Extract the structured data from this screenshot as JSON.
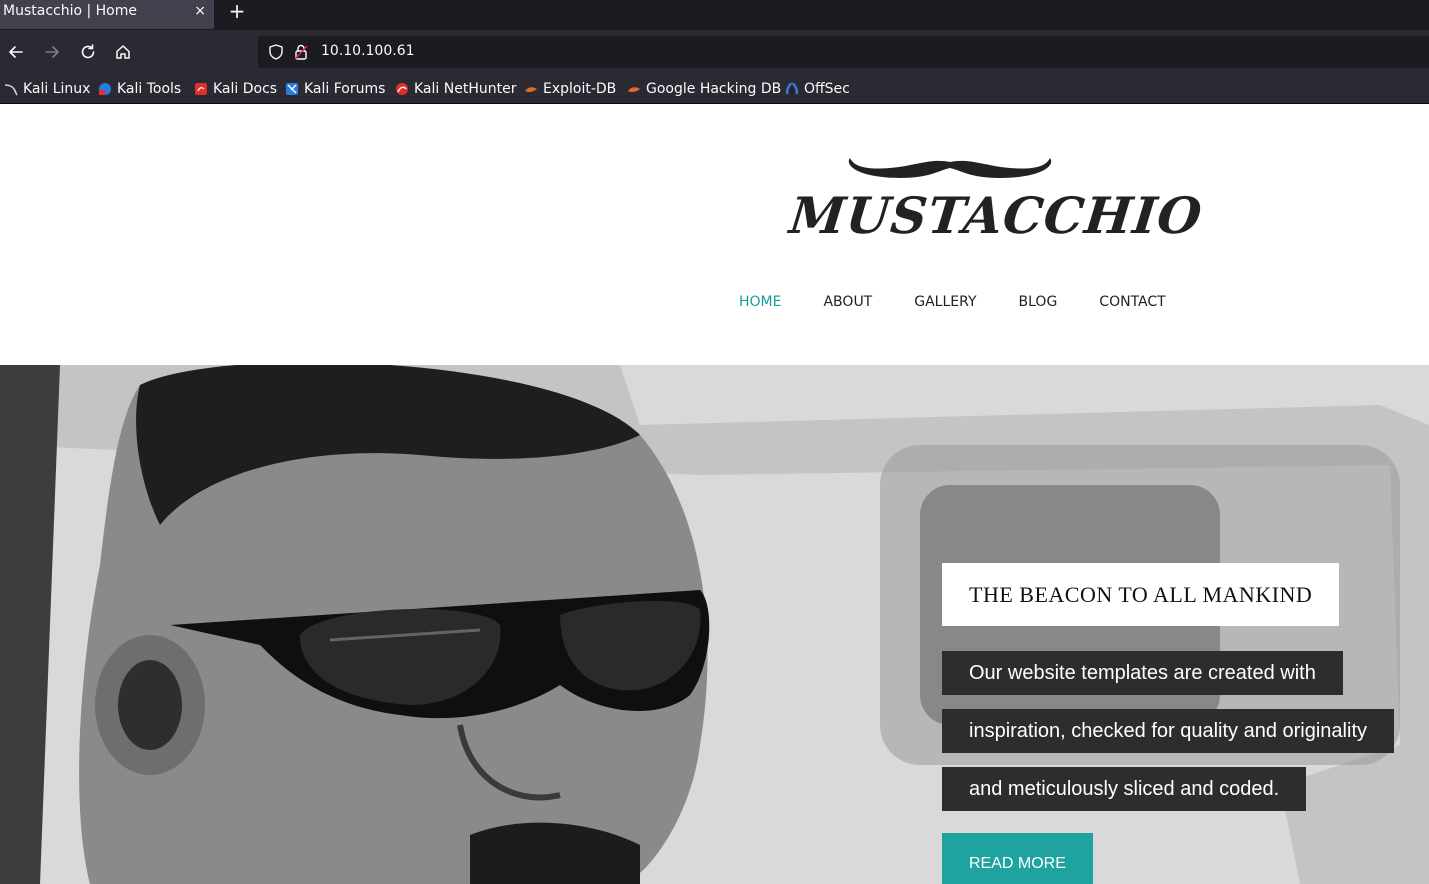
{
  "browser": {
    "tab_title": "Mustacchio | Home",
    "close_glyph": "×",
    "newtab_glyph": "+",
    "url": "10.10.100.61",
    "bookmarks": [
      {
        "label": "Kali Linux",
        "icon": "kali-dragon-icon",
        "color": "#2a7bde"
      },
      {
        "label": "Kali Tools",
        "icon": "kali-tools-icon",
        "color": "#2a7bde"
      },
      {
        "label": "Kali Docs",
        "icon": "kali-docs-icon",
        "color": "#e0302a"
      },
      {
        "label": "Kali Forums",
        "icon": "kali-forums-icon",
        "color": "#2a7bde"
      },
      {
        "label": "Kali NetHunter",
        "icon": "kali-nethunter-icon",
        "color": "#e0302a"
      },
      {
        "label": "Exploit-DB",
        "icon": "exploit-db-icon",
        "color": "#e06a2a"
      },
      {
        "label": "Google Hacking DB",
        "icon": "ghdb-icon",
        "color": "#e06a2a"
      },
      {
        "label": "OffSec",
        "icon": "offsec-icon",
        "color": "#3a7bde"
      }
    ]
  },
  "site": {
    "logo_text": "MUSTACCHIO",
    "nav": [
      {
        "label": "HOME",
        "active": true
      },
      {
        "label": "ABOUT",
        "active": false
      },
      {
        "label": "GALLERY",
        "active": false
      },
      {
        "label": "BLOG",
        "active": false
      },
      {
        "label": "CONTACT",
        "active": false
      }
    ],
    "accent_color": "#1a9c9c"
  },
  "hero": {
    "title": "THE BEACON TO ALL MANKIND",
    "lines": [
      "Our website templates are created with",
      "inspiration, checked for quality and originality",
      "and meticulously sliced and coded."
    ],
    "button_label": "READ MORE",
    "button_color": "#1fa3a0"
  }
}
